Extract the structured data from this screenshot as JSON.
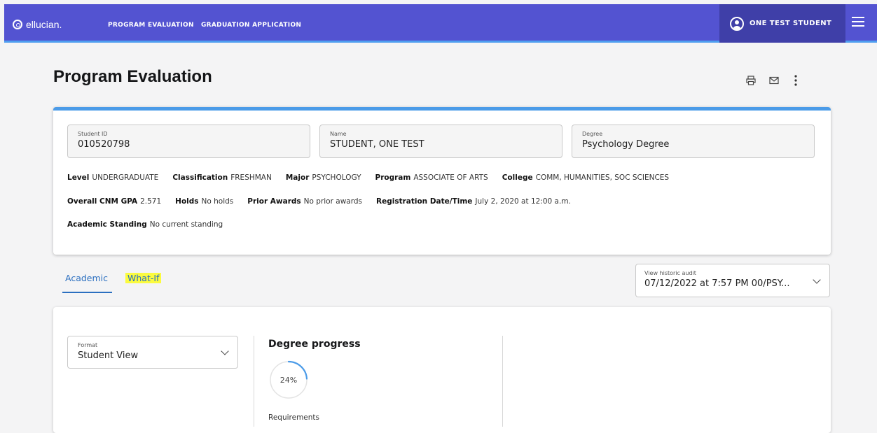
{
  "topbar": {
    "logo_text": "ellucian.",
    "nav": [
      "PROGRAM EVALUATION",
      "GRADUATION APPLICATION"
    ],
    "user_name": "ONE TEST STUDENT",
    "colors": {
      "bar": "#5353d1",
      "user_block": "#3f3fa8",
      "accent": "#4e9ef0"
    }
  },
  "page": {
    "title": "Program Evaluation",
    "actions": [
      "printer-icon",
      "mail-icon",
      "more-vertical-icon"
    ]
  },
  "student": {
    "fields": [
      {
        "label": "Student ID",
        "value": "010520798"
      },
      {
        "label": "Name",
        "value": "STUDENT, ONE TEST"
      },
      {
        "label": "Degree",
        "value": "Psychology Degree"
      }
    ],
    "row1": [
      {
        "label": "Level",
        "value": "UNDERGRADUATE"
      },
      {
        "label": "Classification",
        "value": "FRESHMAN"
      },
      {
        "label": "Major",
        "value": "PSYCHOLOGY"
      },
      {
        "label": "Program",
        "value": "ASSOCIATE OF ARTS"
      },
      {
        "label": "College",
        "value": "COMM, HUMANITIES, SOC SCIENCES"
      }
    ],
    "row2": [
      {
        "label": "Overall CNM GPA",
        "value": "2.571"
      },
      {
        "label": "Holds",
        "value": "No holds"
      },
      {
        "label": "Prior Awards",
        "value": "No prior awards"
      },
      {
        "label": "Registration Date/Time",
        "value": "July 2, 2020 at 12:00 a.m."
      }
    ],
    "row3": [
      {
        "label": "Academic Standing",
        "value": "No current standing"
      }
    ]
  },
  "tabs": {
    "academic": "Academic",
    "whatif": "What-If",
    "highlight_color": "#fbfb3f"
  },
  "historic": {
    "label": "View historic audit",
    "value": "07/12/2022 at 7:57 PM 00/PSY..."
  },
  "evaluation": {
    "format_label": "Format",
    "format_value": "Student View",
    "degree_progress_title": "Degree progress",
    "progress_percent": 24,
    "progress_text": "24%",
    "requirements_label": "Requirements"
  }
}
